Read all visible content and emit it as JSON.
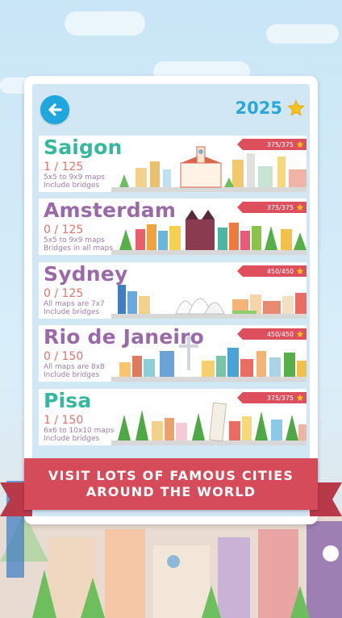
{
  "header": {
    "score": "2025",
    "score_icon": "star-icon",
    "back_icon": "arrow-left-icon"
  },
  "cities": [
    {
      "name": "Saigon",
      "progress": "1 / 125",
      "info1": "5x5 to 9x9 maps",
      "info2": "Include bridges",
      "stars": "375/375",
      "color": "#36b89c"
    },
    {
      "name": "Amsterdam",
      "progress": "0 / 125",
      "info1": "5x5 to 9x9 maps",
      "info2": "Bridges in all maps",
      "stars": "375/375",
      "color": "#9a6aa8"
    },
    {
      "name": "Sydney",
      "progress": "0 / 125",
      "info1": "All maps are 7x7",
      "info2": "Include bridges",
      "stars": "450/450",
      "color": "#9a6aa8"
    },
    {
      "name": "Rio de Janeiro",
      "progress": "0 / 150",
      "info1": "All maps are 8x8",
      "info2": "Include bridges",
      "stars": "450/450",
      "color": "#9a6aa8"
    },
    {
      "name": "Pisa",
      "progress": "1 / 150",
      "info1": "6x6 to 10x10 maps",
      "info2": "Include bridges",
      "stars": "375/375",
      "color": "#36b89c"
    }
  ],
  "banner": {
    "line1": "VISIT LOTS OF FAMOUS CITIES",
    "line2": "AROUND THE WORLD"
  },
  "colors": {
    "accent_blue": "#1ea6dd",
    "ribbon_red": "#d64b5a",
    "star_gold": "#f7c21b"
  }
}
